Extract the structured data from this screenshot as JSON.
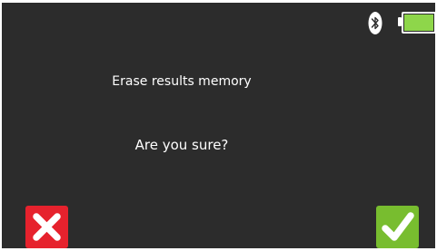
{
  "dialog": {
    "title": "Erase results memory",
    "question": "Are you sure?"
  },
  "status_bar": {
    "bluetooth_icon": "bluetooth-icon",
    "battery_icon": "battery-icon",
    "battery_level": 1.0
  },
  "actions": {
    "cancel_icon": "cross-icon",
    "confirm_icon": "checkmark-icon"
  },
  "colors": {
    "background": "#2c2c2c",
    "cancel": "#e6222d",
    "confirm": "#78bd2f",
    "battery_fill": "#8ed64a"
  }
}
